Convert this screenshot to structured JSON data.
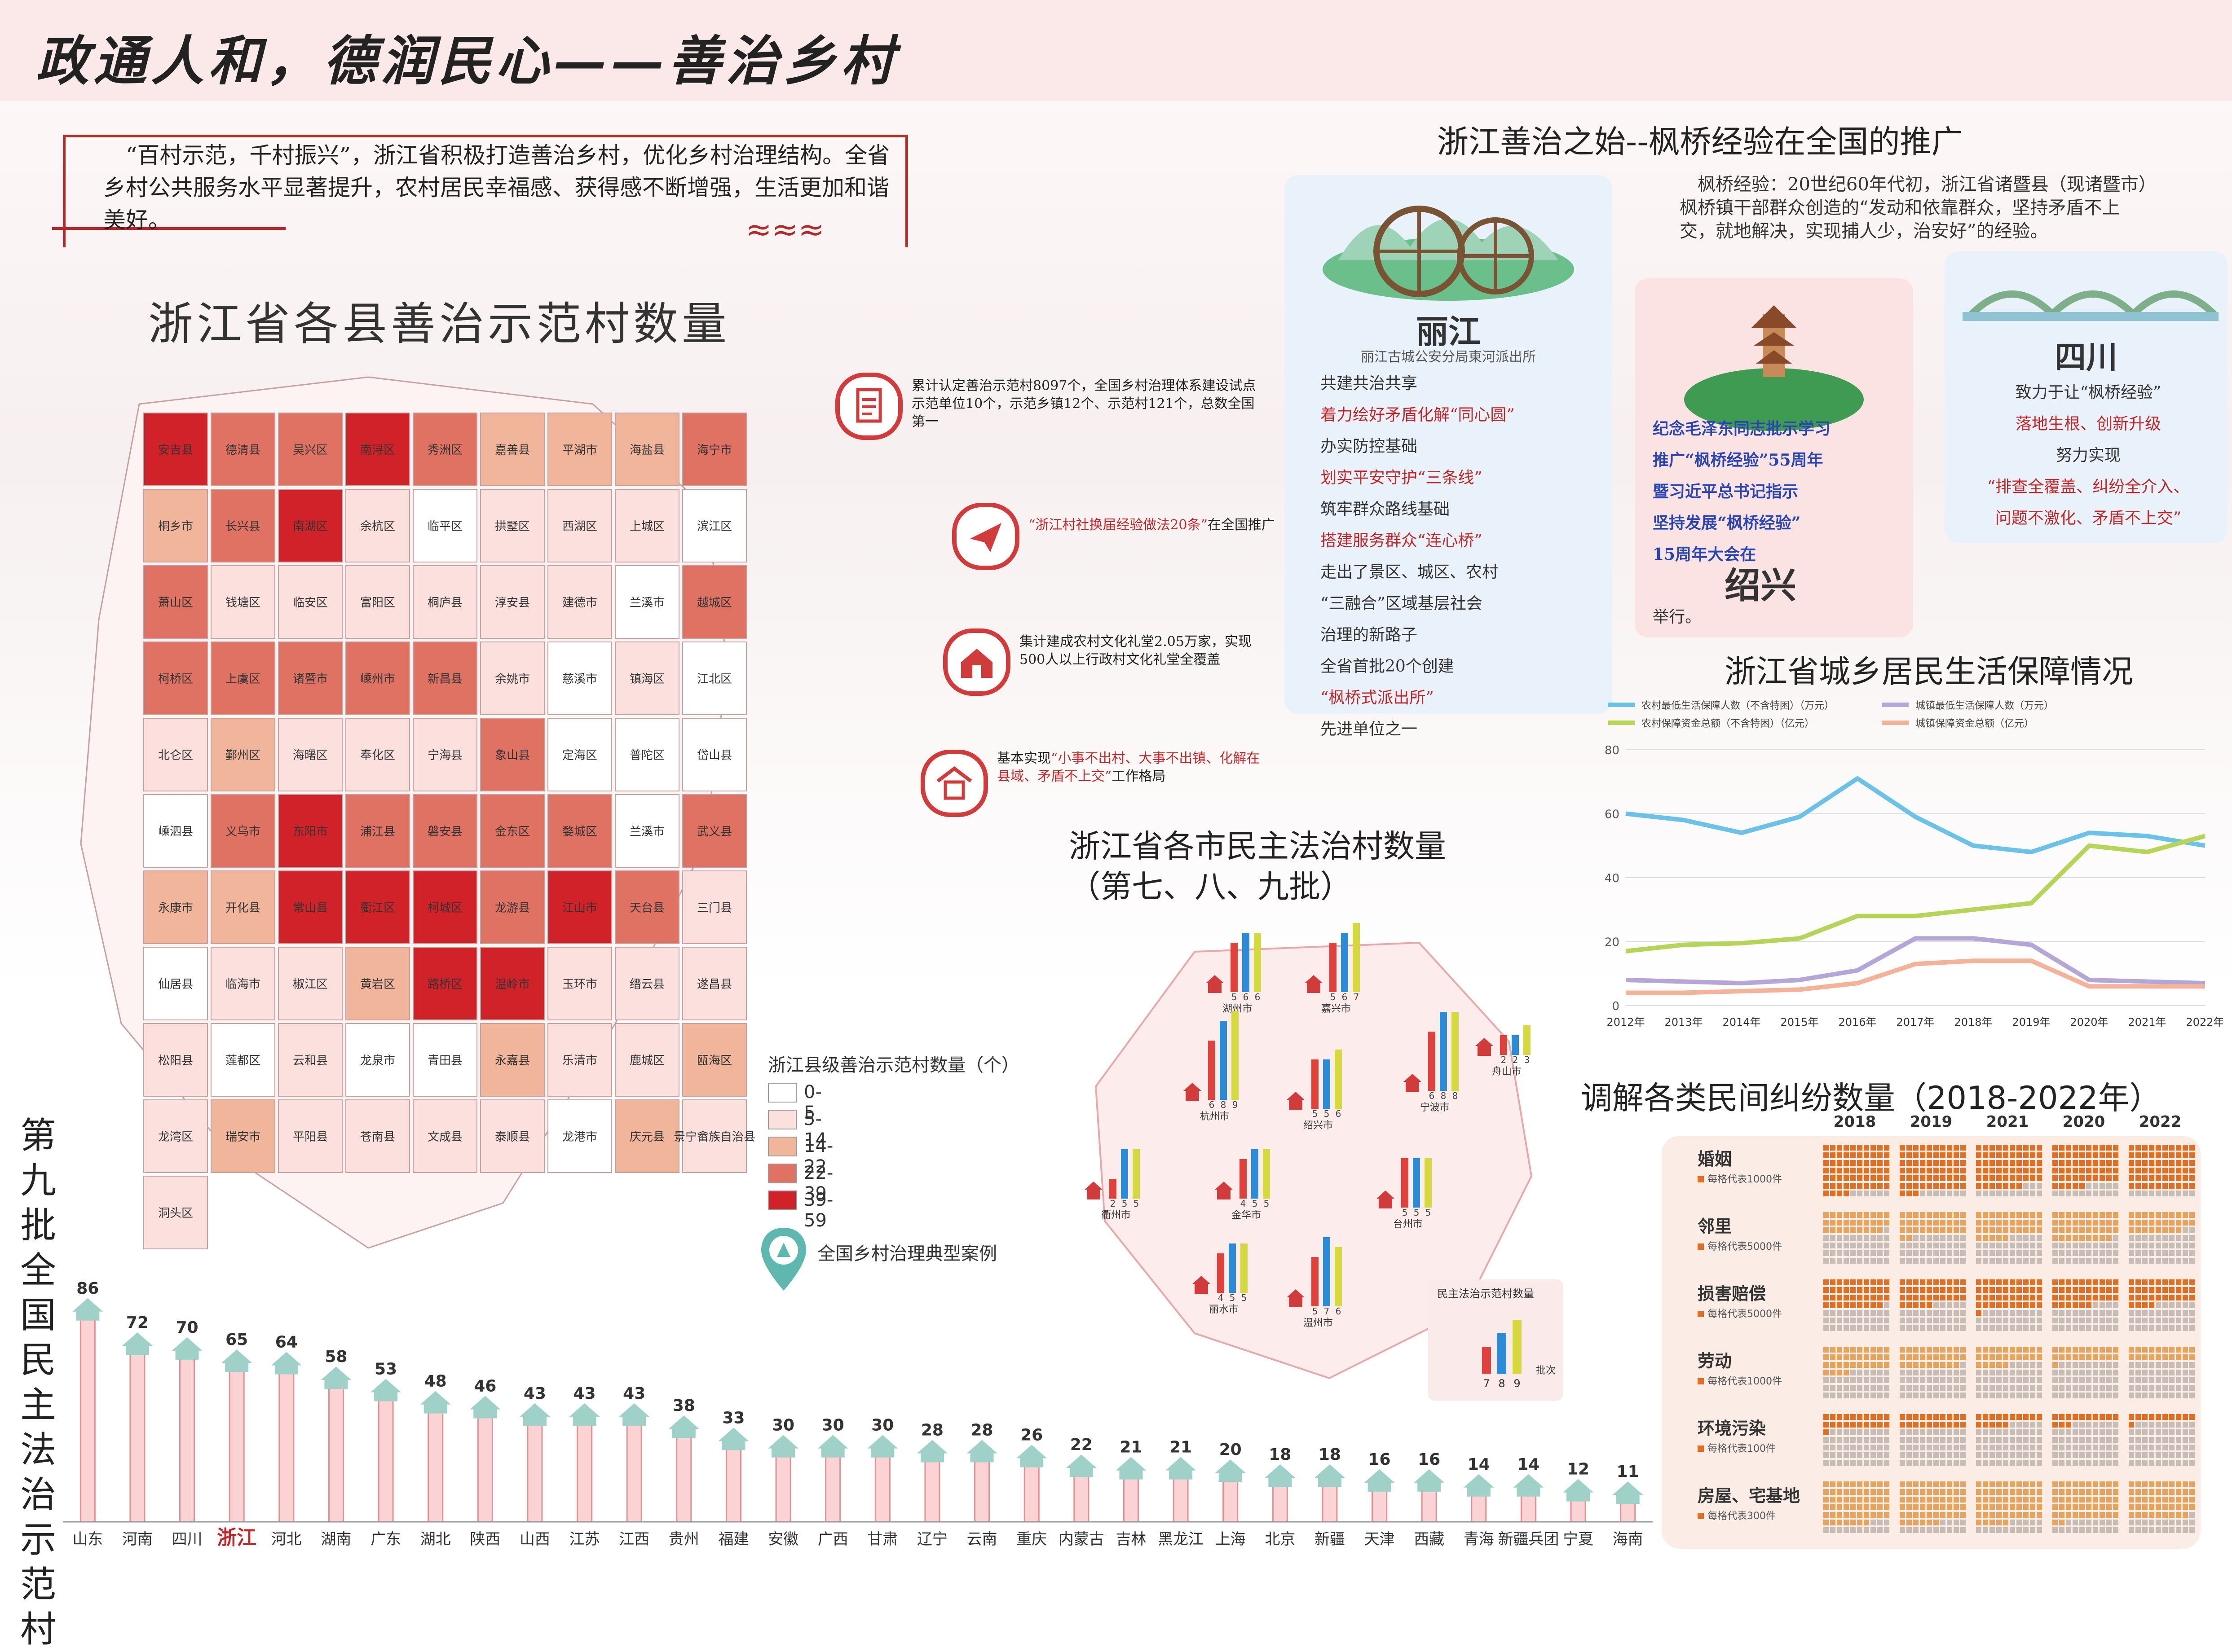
{
  "page": {
    "title": "政通人和，德润民心——善治乡村",
    "intro": "“百村示范，千村振兴”，浙江省积极打造善治乡村，优化乡村治理结构。全省乡村公共服务水平显著提升，农村居民幸福感、获得感不断增强，生活更加和谐美好。"
  },
  "colors": {
    "accent": "#c0262a",
    "title_band": "#fbe8e8",
    "teal": "#5fb8b0",
    "c0": "#ffffff",
    "c1": "#fbe0de",
    "c2": "#f1b59c",
    "c3": "#e07264",
    "c4": "#d1222a"
  },
  "map": {
    "title": "浙江省各县善治示范村数量",
    "legend_title": "浙江县级善治示范村数量（个）",
    "legend": [
      "0-5",
      "5-14",
      "14-22",
      "22-39",
      "39-59"
    ],
    "pin_label": "全国乡村治理典型案例",
    "labels": [
      "安吉县",
      "德清县",
      "吴兴区",
      "南浔区",
      "秀洲区",
      "嘉善县",
      "平湖市",
      "海盐县",
      "海宁市",
      "桐乡市",
      "长兴县",
      "南湖区",
      "余杭区",
      "临平区",
      "拱墅区",
      "西湖区",
      "上城区",
      "滨江区",
      "萧山区",
      "钱塘区",
      "临安区",
      "富阳区",
      "桐庐县",
      "淳安县",
      "建德市",
      "兰溪市",
      "越城区",
      "柯桥区",
      "上虞区",
      "诸暨市",
      "嵊州市",
      "新昌县",
      "余姚市",
      "慈溪市",
      "镇海区",
      "江北区",
      "北仑区",
      "鄞州区",
      "海曙区",
      "奉化区",
      "宁海县",
      "象山县",
      "定海区",
      "普陀区",
      "岱山县",
      "嵊泗县",
      "义乌市",
      "东阳市",
      "浦江县",
      "磐安县",
      "金东区",
      "婺城区",
      "兰溪市",
      "武义县",
      "永康市",
      "开化县",
      "常山县",
      "衢江区",
      "柯城区",
      "龙游县",
      "江山市",
      "天台县",
      "三门县",
      "仙居县",
      "临海市",
      "椒江区",
      "黄岩区",
      "路桥区",
      "温岭市",
      "玉环市",
      "缙云县",
      "遂昌县",
      "松阳县",
      "莲都区",
      "云和县",
      "龙泉市",
      "青田县",
      "永嘉县",
      "乐清市",
      "鹿城区",
      "瓯海区",
      "龙湾区",
      "瑞安市",
      "平阳县",
      "苍南县",
      "文成县",
      "泰顺县",
      "龙港市",
      "庆元县",
      "景宁畲族自治县",
      "洞头区"
    ]
  },
  "notes": [
    {
      "icon": "document-icon",
      "text": "累计认定善治示范村8097个，全国乡村治理体系建设试点示范单位10个，示范乡镇12个、示范村121个，总数全国第一"
    },
    {
      "icon": "paper-plane-icon",
      "text_red": "“浙江村社换届经验做法20条”",
      "text": "在全国推广"
    },
    {
      "icon": "house-icon",
      "text": "集计建成农村文化礼堂2.05万家，实现500人以上行政村文化礼堂全覆盖"
    },
    {
      "icon": "roof-icon",
      "text": "基本实现",
      "text_red": "“小事不出村、大事不出镇、化解在县域、矛盾不上交”",
      "text2": "工作格局"
    }
  ],
  "fengqiao": {
    "title": "浙江善治之始--枫桥经验在全国的推广",
    "desc": "枫桥经验：20世纪60年代初，浙江省诸暨县（现诸暨市）枫桥镇干部群众创造的“发动和依靠群众，坚持矛盾不上交，就地解决，实现捕人少，治安好”的经验。",
    "lijiang": {
      "name": "丽江",
      "sub": "丽江古城公安分局東河派出所",
      "lines": [
        {
          "t": "共建共治共享",
          "r": false
        },
        {
          "t": "着力绘好矛盾化解“同心圆”",
          "r": true
        },
        {
          "t": "办实防控基础",
          "r": false
        },
        {
          "t": "划实平安守护“三条线”",
          "r": true
        },
        {
          "t": "筑牢群众路线基础",
          "r": false
        },
        {
          "t": "搭建服务群众“连心桥”",
          "r": true
        },
        {
          "t": "走出了景区、城区、农村",
          "r": false
        },
        {
          "t": "“三融合”区域基层社会",
          "r": false
        },
        {
          "t": "治理的新路子",
          "r": false
        },
        {
          "t": "全省首批20个创建",
          "r": false
        },
        {
          "t": "“枫桥式派出所”",
          "r": true
        },
        {
          "t": "先进单位之一",
          "r": false
        }
      ]
    },
    "shaoxing": {
      "name": "绍兴",
      "lines": [
        {
          "t": "纪念毛泽东同志批示学习",
          "b": true
        },
        {
          "t": "推广“枫桥经验”55周年",
          "b": true
        },
        {
          "t": "暨习近平总书记指示",
          "b": true
        },
        {
          "t": "坚持发展“枫桥经验”",
          "b": true
        },
        {
          "t": "15周年大会在",
          "b": true
        }
      ],
      "tail": "举行。"
    },
    "sichuan": {
      "name": "四川",
      "lines": [
        {
          "t": "致力于让“枫桥经验”",
          "r": false
        },
        {
          "t": "落地生根、创新升级",
          "r": true
        },
        {
          "t": "努力实现",
          "r": false
        },
        {
          "t": "“排查全覆盖、纠纷全介入、",
          "r": true
        },
        {
          "t": "问题不激化、矛盾不上交”",
          "r": true
        }
      ]
    }
  },
  "life_chart": {
    "title": "浙江省城乡居民生活保障情况",
    "chart_data": {
      "type": "line",
      "x": [
        "2012年",
        "2013年",
        "2014年",
        "2015年",
        "2016年",
        "2017年",
        "2018年",
        "2019年",
        "2020年",
        "2021年",
        "2022年"
      ],
      "ylim": [
        0,
        80
      ],
      "yticks": [
        0,
        20,
        40,
        60,
        80
      ],
      "series": [
        {
          "name": "农村最低生活保障人数（不含特困）（万元）",
          "color": "#6cc1e8",
          "values": [
            60,
            58,
            54,
            59,
            71,
            59,
            50,
            48,
            54,
            53,
            50
          ]
        },
        {
          "name": "城镇最低生活保障人数（万元）",
          "color": "#b5a6d8",
          "values": [
            8,
            7.5,
            7,
            8,
            11,
            21,
            21,
            19,
            8,
            7.5,
            7
          ]
        },
        {
          "name": "农村保障资金总额（不含特困）（亿元）",
          "color": "#b6d45a",
          "values": [
            17,
            19,
            19.5,
            21,
            28,
            28,
            30,
            32,
            50,
            48,
            53
          ]
        },
        {
          "name": "城镇保障资金总额（亿元）",
          "color": "#f4b29a",
          "values": [
            4,
            4,
            4.5,
            5,
            7,
            13,
            14,
            14,
            6,
            6,
            6
          ]
        }
      ]
    }
  },
  "demo_map": {
    "title_line1": "浙江省各市民主法治村数量",
    "title_line2": "（第七、八、九批）",
    "legend_title": "民主法治示范村数量",
    "legend_batch": "批次",
    "legend_nums": [
      "7",
      "8",
      "9"
    ],
    "cities": [
      {
        "name": "湖州市",
        "vals": [
          5,
          6,
          6
        ]
      },
      {
        "name": "嘉兴市",
        "vals": [
          5,
          6,
          7
        ]
      },
      {
        "name": "杭州市",
        "vals": [
          6,
          8,
          9
        ]
      },
      {
        "name": "绍兴市",
        "vals": [
          5,
          5,
          6
        ]
      },
      {
        "name": "宁波市",
        "vals": [
          6,
          8,
          8
        ]
      },
      {
        "name": "舟山市",
        "vals": [
          2,
          2,
          3
        ]
      },
      {
        "name": "衢州市",
        "vals": [
          2,
          5,
          5
        ]
      },
      {
        "name": "金华市",
        "vals": [
          4,
          5,
          5
        ]
      },
      {
        "name": "台州市",
        "vals": [
          5,
          5,
          5
        ]
      },
      {
        "name": "丽水市",
        "vals": [
          4,
          5,
          5
        ]
      },
      {
        "name": "温州市",
        "vals": [
          5,
          7,
          6
        ]
      }
    ]
  },
  "dispute": {
    "title": "调解各类民间纠纷数量（2018-2022年）",
    "years": [
      "2018",
      "2019",
      "2021",
      "2020",
      "2022"
    ],
    "rows": [
      {
        "name": "婚姻",
        "unit": "每格代表1000件",
        "fills": [
          0.92,
          0.9,
          0.82,
          0.78,
          0.85
        ]
      },
      {
        "name": "邻里",
        "unit": "每格代表5000件",
        "fills": [
          0.42,
          0.45,
          0.5,
          0.55,
          0.4
        ]
      },
      {
        "name": "损害赔偿",
        "unit": "每格代表5000件",
        "fills": [
          0.55,
          0.5,
          0.58,
          0.52,
          0.48
        ]
      },
      {
        "name": "劳动",
        "unit": "每格代表1000件",
        "fills": [
          0.48,
          0.42,
          0.35,
          0.3,
          0.28
        ]
      },
      {
        "name": "环境污染",
        "unit": "每格代表100件",
        "fills": [
          0.3,
          0.28,
          0.22,
          0.18,
          0.16
        ]
      },
      {
        "name": "房屋、宅基地",
        "unit": "每格代表300件",
        "fills": [
          0.82,
          0.8,
          0.78,
          0.74,
          0.7
        ]
      }
    ]
  },
  "ninth_chart": {
    "title": "第九批全国民主法治示范村",
    "chart_data": {
      "type": "bar",
      "categories": [
        "山东",
        "河南",
        "四川",
        "浙江",
        "河北",
        "湖南",
        "广东",
        "湖北",
        "陕西",
        "山西",
        "江苏",
        "江西",
        "贵州",
        "福建",
        "安徽",
        "广西",
        "甘肃",
        "辽宁",
        "云南",
        "重庆",
        "内蒙古",
        "吉林",
        "黑龙江",
        "上海",
        "北京",
        "新疆",
        "天津",
        "西藏",
        "青海",
        "新疆兵团",
        "宁夏",
        "海南"
      ],
      "values": [
        86,
        72,
        70,
        65,
        64,
        58,
        53,
        48,
        46,
        43,
        43,
        43,
        38,
        33,
        30,
        30,
        30,
        28,
        28,
        26,
        22,
        21,
        21,
        20,
        18,
        18,
        16,
        16,
        14,
        14,
        12,
        11
      ],
      "ylim": [
        0,
        90
      ],
      "highlight": "浙江"
    }
  }
}
